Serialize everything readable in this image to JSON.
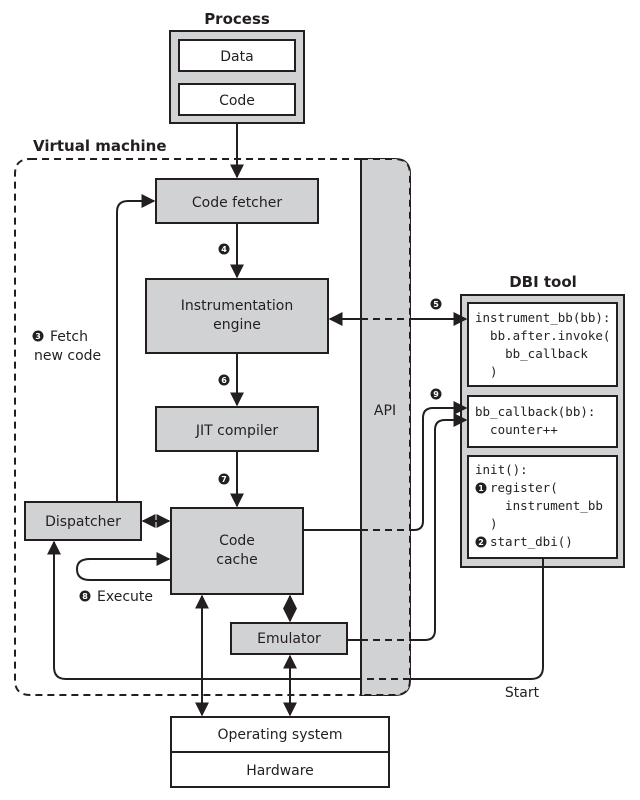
{
  "process": {
    "title": "Process",
    "data_label": "Data",
    "code_label": "Code"
  },
  "vm": {
    "title": "Virtual machine",
    "code_fetcher": "Code fetcher",
    "instrumentation_engine": [
      "Instrumentation",
      "engine"
    ],
    "jit_compiler": "JIT compiler",
    "code_cache": [
      "Code",
      "cache"
    ],
    "dispatcher": "Dispatcher",
    "emulator": "Emulator",
    "api": "API"
  },
  "steps": {
    "s3": {
      "num": "3",
      "label": [
        "Fetch",
        "new code"
      ]
    },
    "s4": {
      "num": "4"
    },
    "s5": {
      "num": "5"
    },
    "s6": {
      "num": "6"
    },
    "s7": {
      "num": "7"
    },
    "s8": {
      "num": "8",
      "label": "Execute"
    },
    "s9": {
      "num": "9"
    }
  },
  "dbi_tool": {
    "title": "DBI tool",
    "instrument_code": [
      "instrument_bb(bb):",
      "  bb.after.invoke(",
      "    bb_callback",
      "  )"
    ],
    "callback_code": [
      "bb_callback(bb):",
      "  counter++"
    ],
    "init_code": {
      "line1": "init():",
      "step1_num": "1",
      "line2": "register(",
      "line3": "  instrument_bb",
      "line4": "  )",
      "step2_num": "2",
      "line5": "start_dbi()"
    },
    "start_label": "Start"
  },
  "system": {
    "os": "Operating system",
    "hardware": "Hardware"
  }
}
